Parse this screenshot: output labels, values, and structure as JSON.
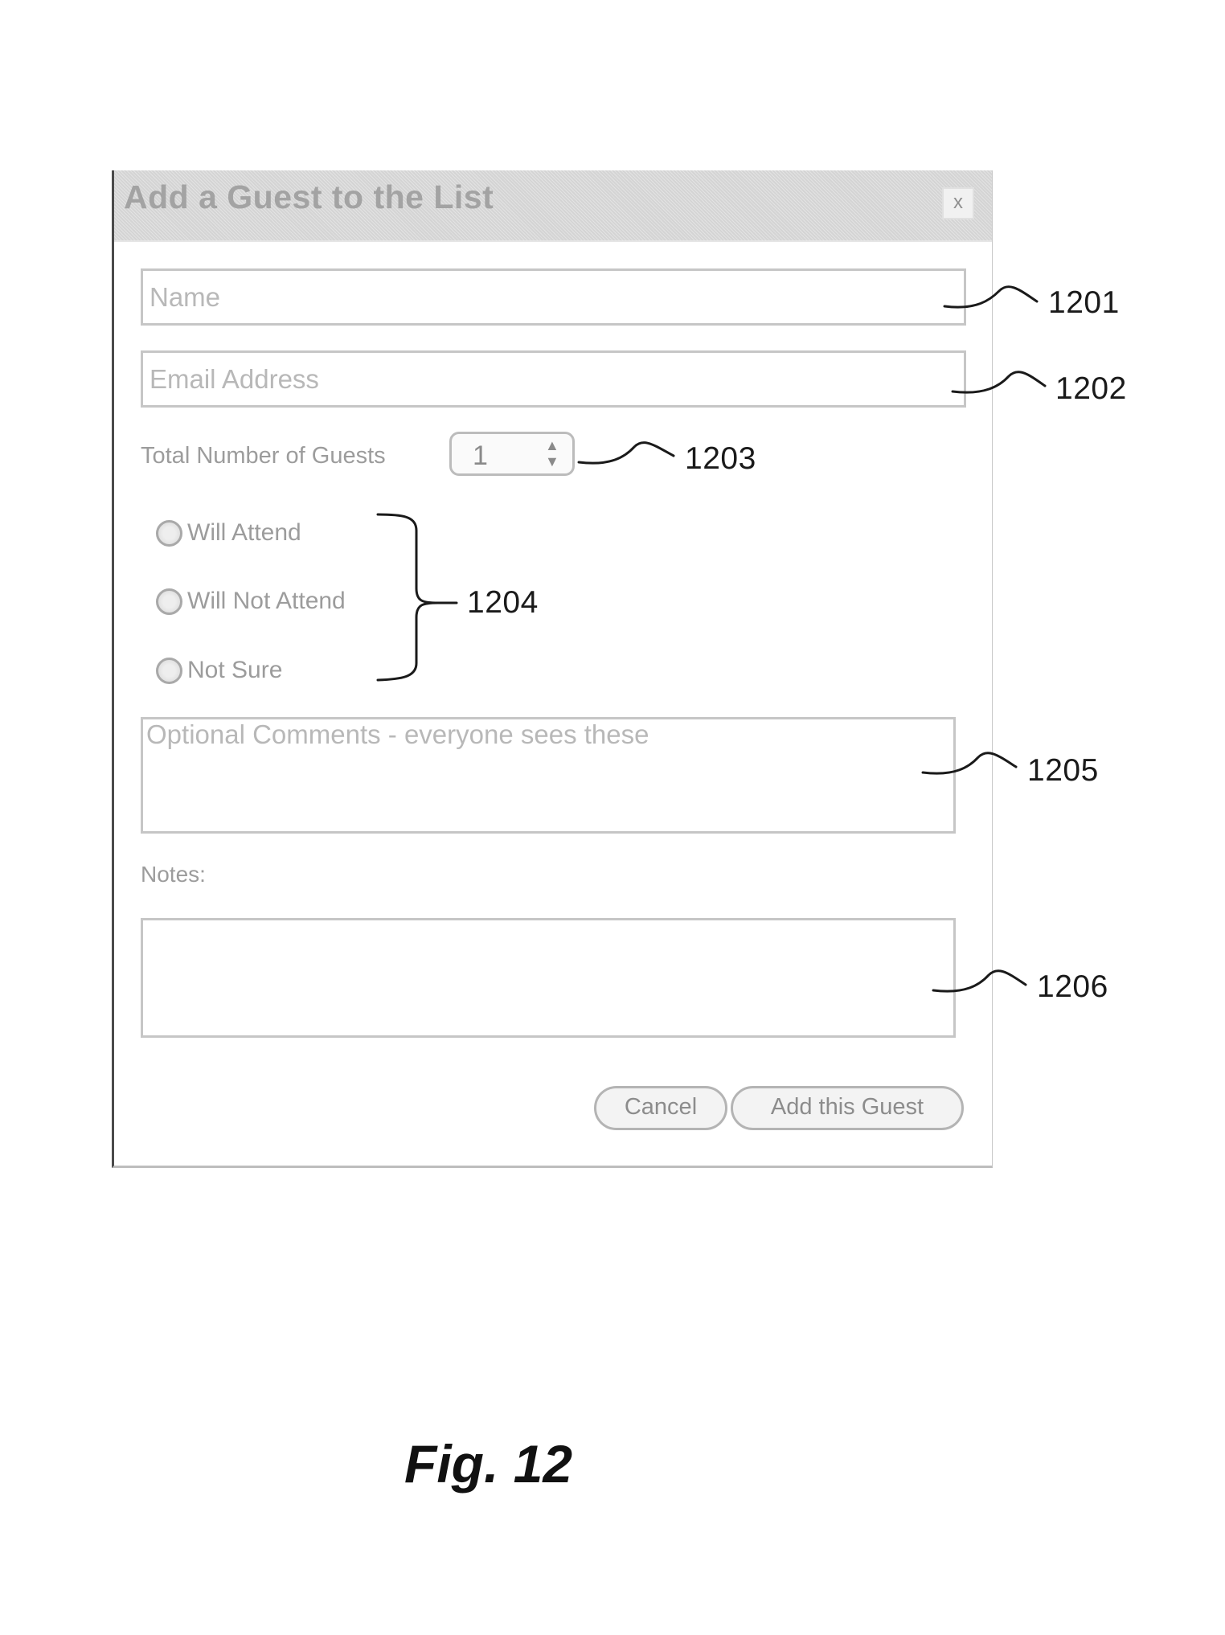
{
  "dialog": {
    "title": "Add a Guest to the List",
    "close_label": "x",
    "name_placeholder": "Name",
    "email_placeholder": "Email Address",
    "guests_label": "Total Number of Guests",
    "guests_value": "1",
    "attendance_options": [
      "Will Attend",
      "Will Not Attend",
      "Not Sure"
    ],
    "comments_placeholder": "Optional Comments - everyone sees these",
    "notes_label": "Notes:",
    "cancel_label": "Cancel",
    "add_label": "Add this Guest"
  },
  "callouts": {
    "name": "1201",
    "email": "1202",
    "guests": "1203",
    "attendance": "1204",
    "comments": "1205",
    "notes": "1206"
  },
  "figure_caption": "Fig. 12"
}
